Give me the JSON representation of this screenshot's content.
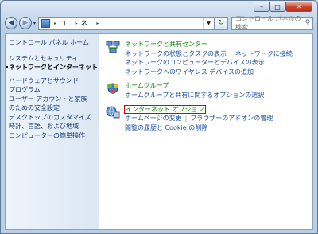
{
  "window": {
    "minimize": "–",
    "maximize": "□",
    "close": "✕"
  },
  "nav": {
    "history": "▾",
    "address": [
      "コ...",
      "ネ..."
    ],
    "search_placeholder": "コントロール パネルの検索"
  },
  "sidebar": {
    "home": "コントロール パネル ホーム",
    "items": [
      "システムとセキュリティ",
      "ネットワークとインターネット",
      "ハードウェアとサウンド",
      "プログラム",
      "ユーザー アカウントと家族",
      "のための安全設定",
      "デスクトップのカスタマイズ",
      "時計、言語、および地域",
      "コンピューターの簡単操作"
    ]
  },
  "categories": [
    {
      "icon": "network-sharing-center-icon",
      "title": "ネットワークと共有センター",
      "links": [
        [
          "ネットワークの状態とタスクの表示",
          "ネットワークに接続"
        ],
        [
          "ネットワークのコンピューターとデバイスの表示"
        ],
        [
          "ネットワークへのワイヤレス デバイスの追加"
        ]
      ]
    },
    {
      "icon": "homegroup-icon",
      "title": "ホームグループ",
      "links": [
        [
          "ホームグループと共有に関するオプションの選択"
        ]
      ]
    },
    {
      "icon": "internet-options-icon",
      "title": "インターネット オプション",
      "links": [
        [
          "ホームページの変更",
          "ブラウザーのアドオンの管理"
        ],
        [
          "閲覧の履歴と Cookie の削除"
        ]
      ]
    }
  ]
}
